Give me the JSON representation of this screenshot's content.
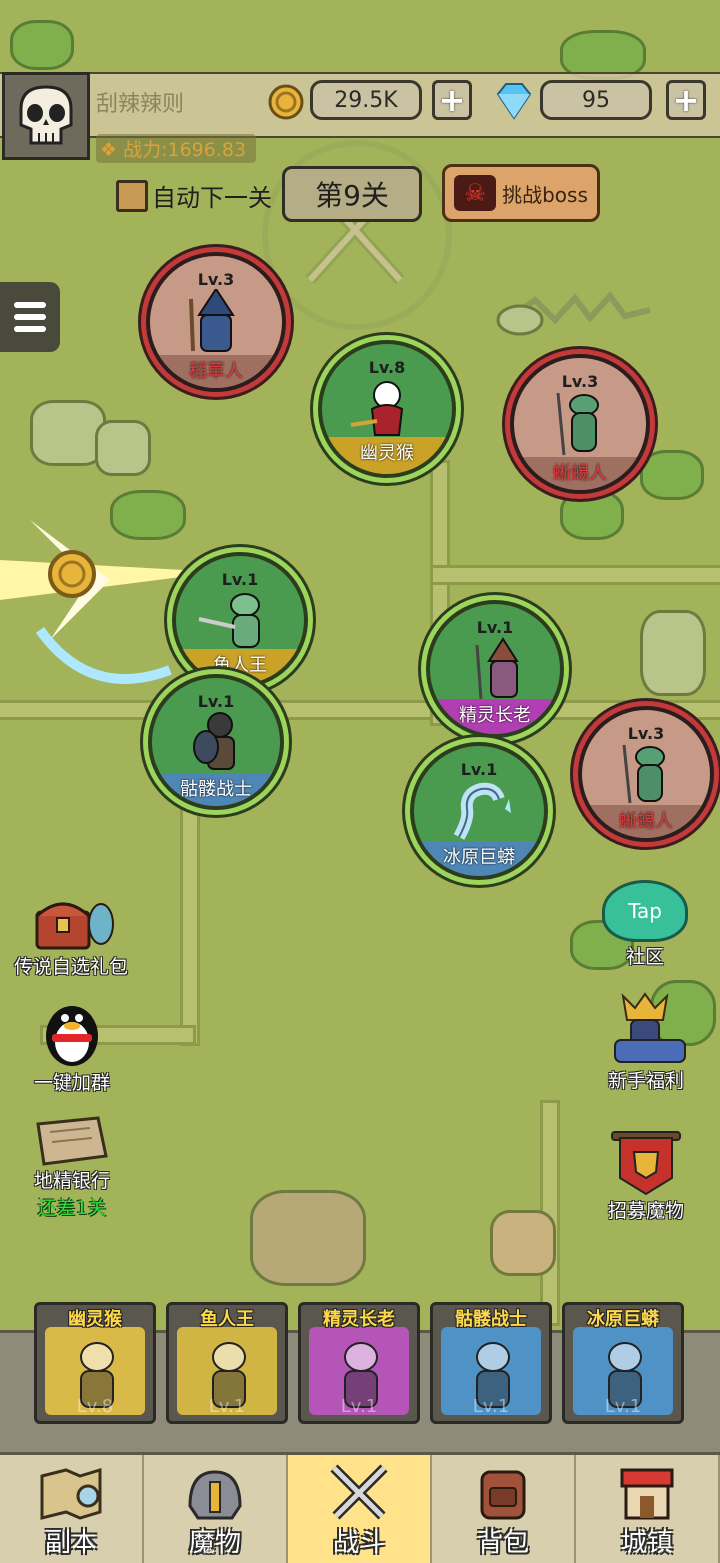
{
  "player": {
    "name": "刮辣辣则",
    "power": "战力:1696.83"
  },
  "currency": {
    "gold": "29.5K",
    "gems": "95",
    "add": "+"
  },
  "stage": {
    "auto_next_label": "自动下一关",
    "stage_label": "第9关",
    "boss_label": "挑战boss"
  },
  "monsters": [
    {
      "level": "Lv.3",
      "name": "稻草人",
      "side": "enemy"
    },
    {
      "level": "Lv.8",
      "name": "幽灵猴",
      "side": "friend"
    },
    {
      "level": "Lv.3",
      "name": "蜥蜴人",
      "side": "enemy"
    },
    {
      "level": "Lv.1",
      "name": "鱼人王",
      "side": "friend"
    },
    {
      "level": "Lv.1",
      "name": "精灵长老",
      "side": "friend"
    },
    {
      "level": "Lv.1",
      "name": "骷髅战士",
      "side": "friend"
    },
    {
      "level": "Lv.3",
      "name": "蜥蜴人",
      "side": "enemy"
    },
    {
      "level": "Lv.1",
      "name": "冰原巨蟒",
      "side": "friend"
    }
  ],
  "left_buttons": {
    "gift": "传说自选礼包",
    "join_group": "一键加群",
    "bank": "地精银行",
    "bank_status": "还差1关"
  },
  "right_buttons": {
    "tap_logo": "Tap",
    "community": "社区",
    "newbie": "新手福利",
    "recruit": "招募魔物"
  },
  "team": [
    {
      "name": "幽灵猴",
      "level": "Lv.8",
      "color": "#d9b948"
    },
    {
      "name": "鱼人王",
      "level": "Lv.1",
      "color": "#d0b545"
    },
    {
      "name": "精灵长老",
      "level": "Lv.1",
      "color": "#b555b8"
    },
    {
      "name": "骷髅战士",
      "level": "Lv.1",
      "color": "#4f93c6"
    },
    {
      "name": "冰原巨蟒",
      "level": "Lv.1",
      "color": "#4f93c6"
    }
  ],
  "nav": [
    {
      "label": "副本",
      "icon": "map-scroll-icon"
    },
    {
      "label": "魔物",
      "icon": "helmet-icon"
    },
    {
      "label": "战斗",
      "icon": "crossed-swords-icon",
      "active": true
    },
    {
      "label": "背包",
      "icon": "backpack-icon"
    },
    {
      "label": "城镇",
      "icon": "shop-icon"
    }
  ],
  "colors": {
    "friend_ring": "#9cd45c",
    "enemy_ring": "#c33a3a",
    "gold_text": "#ffd84a",
    "active_tab": "#ffe28a"
  }
}
